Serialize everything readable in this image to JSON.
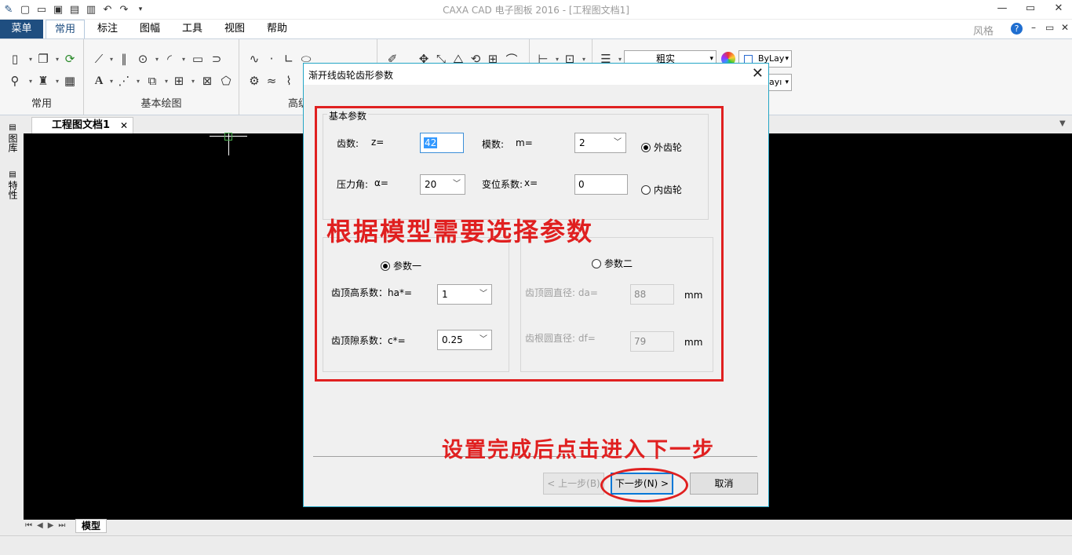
{
  "window": {
    "title": "CAXA CAD 电子图板 2016 - [工程图文档1]",
    "minimize": "—",
    "restore": "▭",
    "close": "✕"
  },
  "menubar": {
    "menu_button": "菜单",
    "tabs": [
      "常用",
      "标注",
      "图幅",
      "工具",
      "视图",
      "帮助"
    ],
    "active_tab": "常用",
    "style_label": "风格"
  },
  "ribbon": {
    "groups": [
      "常用",
      "基本绘图",
      "高级"
    ],
    "layer_value": "粗实",
    "bylayer1": "ByLay",
    "bylayer2": "ayı"
  },
  "document": {
    "tab_title": "工程图文档1",
    "model_tab": "模型",
    "left_tabs": [
      "图库",
      "特性"
    ]
  },
  "dialog": {
    "title": "渐开线齿轮齿形参数",
    "basic_group": "基本参数",
    "teeth_label": "齿数:",
    "teeth_var": "z=",
    "teeth_value": "42",
    "module_label": "模数:",
    "module_var": "m=",
    "module_value": "2",
    "pressure_label": "压力角:",
    "pressure_var": "α=",
    "pressure_value": "20",
    "shift_label": "变位系数:",
    "shift_var": "x=",
    "shift_value": "0",
    "external_gear": "外齿轮",
    "internal_gear": "内齿轮",
    "param1": "参数一",
    "addendum_label": "齿顶高系数：ha*=",
    "addendum_value": "1",
    "clearance_label": "齿顶隙系数：c*=",
    "clearance_value": "0.25",
    "param2": "参数二",
    "tip_dia_label": "齿顶圆直径:  da=",
    "tip_dia_value": "88",
    "root_dia_label": "齿根圆直径:  df=",
    "root_dia_value": "79",
    "unit": "mm",
    "prev_button": "< 上一步(B)",
    "next_button": "下一步(N) >",
    "cancel_button": "取消"
  },
  "annotations": {
    "choose_params": "根据模型需要选择参数",
    "click_next": "设置完成后点击进入下一步"
  },
  "colors": {
    "accent": "#1f4e80",
    "annotation_red": "#e02020",
    "dialog_border": "#24a6c6"
  }
}
